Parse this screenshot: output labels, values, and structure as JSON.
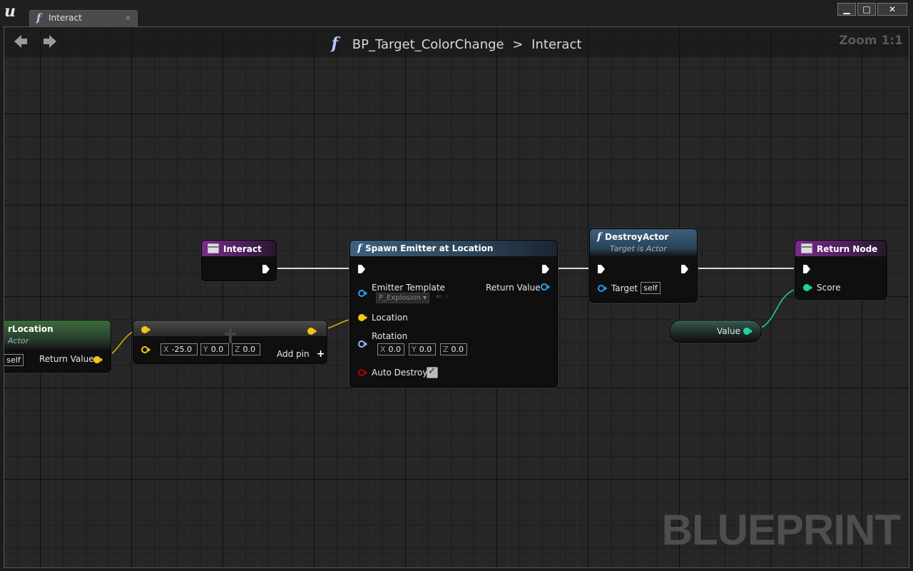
{
  "window": {
    "tab_label": "Interact",
    "tab_icon": "function-icon",
    "minimize": "▁",
    "maximize": "□",
    "close": "✕"
  },
  "navbar": {
    "breadcrumb_icon": "function-icon",
    "breadcrumb_parent": "BP_Target_ColorChange",
    "breadcrumb_separator": ">",
    "breadcrumb_current": "Interact",
    "zoom": "Zoom 1:1"
  },
  "watermark": "BLUEPRINT",
  "nodes": {
    "get_location": {
      "title": "rLocation",
      "subtitle": "Actor",
      "target_value": "self",
      "return_label": "Return Value"
    },
    "make_array": {
      "x_label": "X",
      "x_value": "-25.0",
      "y_label": "Y",
      "y_value": "0.0",
      "z_label": "Z",
      "z_value": "0.0",
      "add_pin_label": "Add pin",
      "add_pin_icon": "+"
    },
    "interact": {
      "title": "Interact"
    },
    "spawn_emitter": {
      "title": "Spawn Emitter at Location",
      "emitter_template_label": "Emitter Template",
      "emitter_template_value": "P_Explosion",
      "return_label": "Return Value",
      "location_label": "Location",
      "rotation_label": "Rotation",
      "rot_x_label": "X",
      "rot_x_value": "0.0",
      "rot_y_label": "Y",
      "rot_y_value": "0.0",
      "rot_z_label": "Z",
      "rot_z_value": "0.0",
      "auto_destroy_label": "Auto Destroy",
      "auto_destroy_checked": true
    },
    "destroy_actor": {
      "title": "DestroyActor",
      "subtitle": "Target is Actor",
      "target_label": "Target",
      "target_value": "self"
    },
    "return_node": {
      "title": "Return Node",
      "score_label": "Score"
    },
    "value_node": {
      "label": "Value"
    }
  },
  "colors": {
    "exec": "#ffffff",
    "vector_pin": "#f5c518",
    "object_pin": "#2aa0e8",
    "rotator_pin": "#9fb5ff",
    "bool_pin": "#b00000",
    "int_pin": "#1ed2a4",
    "function_header": "#3d5f7e",
    "event_header": "#7a2b8f",
    "pure_header": "#3c6b3c"
  }
}
